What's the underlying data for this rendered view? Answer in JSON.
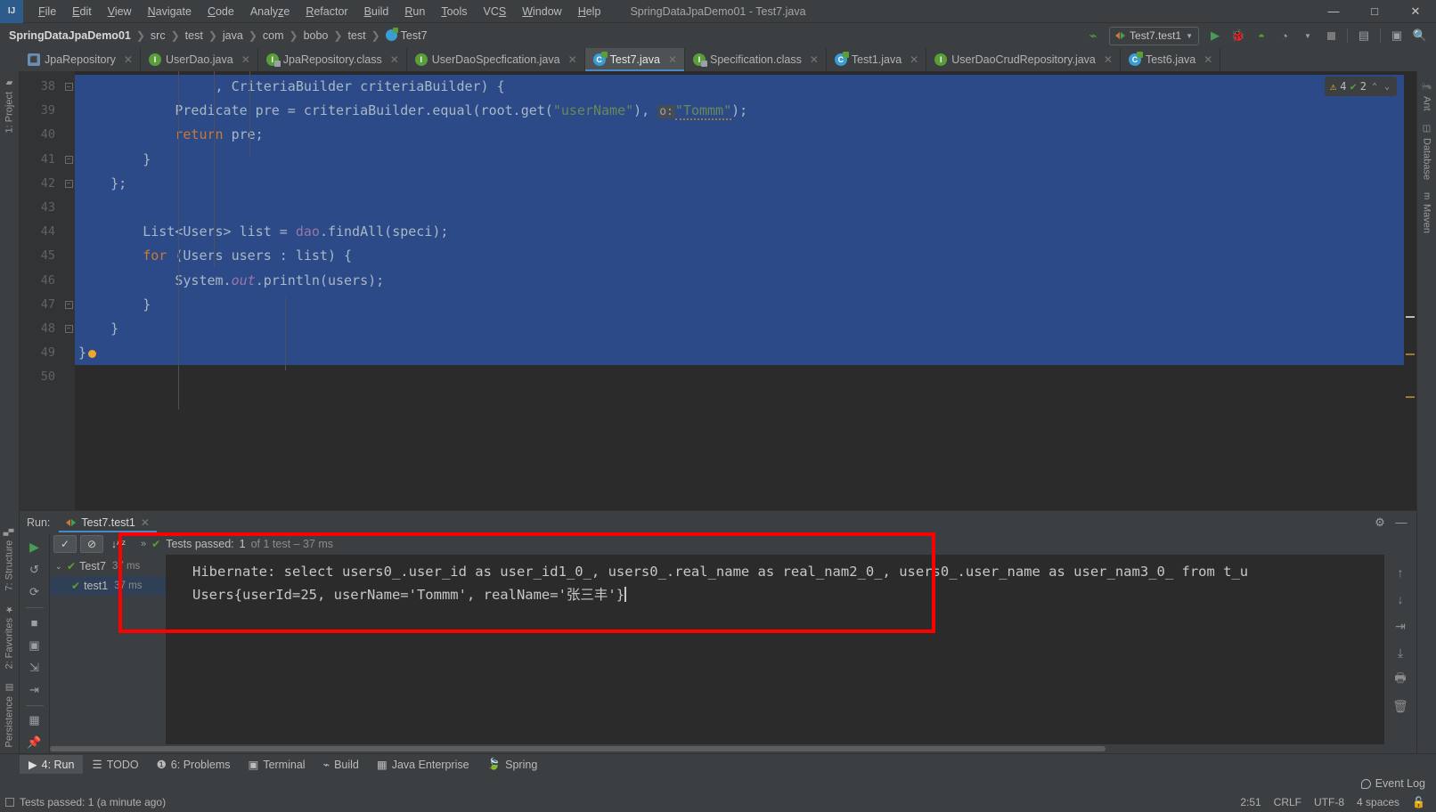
{
  "window": {
    "title": "SpringDataJpaDemo01 - Test7.java",
    "logo": "IJ",
    "minimize": "—",
    "maximize": "□",
    "close": "✕"
  },
  "menu": [
    {
      "label": "File"
    },
    {
      "label": "Edit"
    },
    {
      "label": "View"
    },
    {
      "label": "Navigate"
    },
    {
      "label": "Code"
    },
    {
      "label": "Analyze"
    },
    {
      "label": "Refactor"
    },
    {
      "label": "Build"
    },
    {
      "label": "Run"
    },
    {
      "label": "Tools"
    },
    {
      "label": "VCS"
    },
    {
      "label": "Window"
    },
    {
      "label": "Help"
    }
  ],
  "breadcrumbs": [
    {
      "label": "SpringDataJpaDemo01"
    },
    {
      "label": "src"
    },
    {
      "label": "test"
    },
    {
      "label": "java"
    },
    {
      "label": "com"
    },
    {
      "label": "bobo"
    },
    {
      "label": "test"
    },
    {
      "label": "Test7"
    }
  ],
  "toolbar": {
    "run_config": "Test7.test1",
    "build_title": "build-hammer-icon",
    "run_title": "Run",
    "debug_title": "Debug",
    "coverage_title": "Run with Coverage",
    "profile_title": "Profiler",
    "stop_title": "Stop",
    "updates_title": "Update Project",
    "search_title": "Search Everywhere"
  },
  "editor_tabs": [
    {
      "label": "JpaRepository",
      "icon": "repository-icon",
      "active": false
    },
    {
      "label": "UserDao.java",
      "icon": "interface-icon",
      "active": false
    },
    {
      "label": "JpaRepository.class",
      "icon": "class-file-icon",
      "active": false
    },
    {
      "label": "UserDaoSpecfication.java",
      "icon": "interface-icon",
      "active": false
    },
    {
      "label": "Test7.java",
      "icon": "test-class-icon",
      "active": true
    },
    {
      "label": "Specification.class",
      "icon": "class-file-icon",
      "active": false
    },
    {
      "label": "Test1.java",
      "icon": "test-class-icon",
      "active": false
    },
    {
      "label": "UserDaoCrudRepository.java",
      "icon": "interface-icon",
      "active": false
    },
    {
      "label": "Test6.java",
      "icon": "test-class-icon",
      "active": false
    }
  ],
  "left_rail": [
    {
      "label": "1: Project",
      "icon": "folder-icon"
    },
    {
      "label": "7: Structure",
      "icon": "structure-icon"
    },
    {
      "label": "2: Favorites",
      "icon": "star-icon"
    },
    {
      "label": "Persistence",
      "icon": "persistence-icon"
    }
  ],
  "right_rail": [
    {
      "label": "Ant",
      "icon": "ant-icon"
    },
    {
      "label": "Database",
      "icon": "database-icon"
    },
    {
      "label": "Maven",
      "icon": "maven-icon"
    }
  ],
  "editor": {
    "first_line": 38,
    "lines": [
      {
        "num": 38,
        "selected": true,
        "fold": "minus",
        "tokens": [
          {
            "t": "            , CriteriaBuilder criteriaBuilder) {",
            "c": "n"
          }
        ]
      },
      {
        "num": 39,
        "selected": true,
        "fold": "",
        "tokens": []
      },
      {
        "num": 40,
        "selected": true,
        "fold": "",
        "tokens": []
      },
      {
        "num": 41,
        "selected": true,
        "fold": "minus",
        "tokens": []
      },
      {
        "num": 42,
        "selected": true,
        "fold": "minus",
        "tokens": []
      },
      {
        "num": 43,
        "selected": true,
        "fold": "",
        "tokens": []
      },
      {
        "num": 44,
        "selected": true,
        "fold": "",
        "tokens": []
      },
      {
        "num": 45,
        "selected": true,
        "fold": "",
        "tokens": []
      },
      {
        "num": 46,
        "selected": true,
        "fold": "",
        "tokens": []
      },
      {
        "num": 47,
        "selected": true,
        "fold": "minus",
        "tokens": []
      },
      {
        "num": 48,
        "selected": true,
        "fold": "minus",
        "tokens": []
      },
      {
        "num": 49,
        "selected": true,
        "fold": "",
        "tokens": []
      },
      {
        "num": 50,
        "selected": false,
        "fold": "",
        "tokens": []
      }
    ],
    "code_text": {
      "l38_comma": ",",
      "l38_rest": " CriteriaBuilder criteriaBuilder) {",
      "l39_a": "Predicate pre = criteriaBuilder.equal(root.get(",
      "l39_str1": "\"userName\"",
      "l39_b": "), ",
      "l39_hint": "o:",
      "l39_str2": "\"Tommm\"",
      "l39_c": ");",
      "l40_kw": "return",
      "l40_rest": " pre;",
      "l41": "}",
      "l42": "};",
      "l44_a": "List<Users> list = ",
      "l44_dao": "dao",
      "l44_b": ".findAll(speci);",
      "l45_kw": "for",
      "l45_rest": " (Users users : list) {",
      "l46_a": "System.",
      "l46_out": "out",
      "l46_b": ".println(users);",
      "l47": "}",
      "l48": "}",
      "l49": "}"
    },
    "inspection": {
      "warning_count": "4",
      "ok_count": "2",
      "up": "⌃",
      "down": "⌄"
    }
  },
  "run_panel": {
    "label": "Run:",
    "tab": "Test7.test1",
    "tab_close": "✕",
    "settings_icon": "gear-icon",
    "hide_icon": "minimize-icon",
    "left_toolbar": [
      {
        "name": "rerun-icon",
        "glyph": "▶"
      },
      {
        "name": "rerun-failed-icon",
        "glyph": "↺"
      },
      {
        "name": "toggle-auto-test-icon",
        "glyph": "⟳"
      },
      {
        "name": "stop-icon",
        "glyph": "■"
      },
      {
        "name": "export-icon",
        "glyph": "▣"
      },
      {
        "name": "import-icon",
        "glyph": "⇲"
      },
      {
        "name": "open-icon",
        "glyph": "⇥"
      },
      {
        "name": "layout-icon",
        "glyph": "▦"
      },
      {
        "name": "pin-icon",
        "glyph": "📌"
      }
    ],
    "toggles": [
      {
        "name": "show-passed-toggle",
        "glyph": "✓",
        "on": true
      },
      {
        "name": "hide-ignored-toggle",
        "glyph": "⊘",
        "on": true
      },
      {
        "name": "sort-alphabetically-toggle",
        "glyph": "↓ᴬᶻ",
        "on": false
      }
    ],
    "status": {
      "expand_glyph": "»",
      "check_glyph": "✔",
      "prefix": "Tests passed:",
      "count": "1",
      "suffix": "of 1 test – 37 ms"
    },
    "tree": [
      {
        "label": "Test7",
        "time": "37 ms",
        "expanded": true,
        "selected": false,
        "level": 0
      },
      {
        "label": "test1",
        "time": "37 ms",
        "expanded": false,
        "selected": true,
        "level": 1
      }
    ],
    "console_lines": [
      "Hibernate: select users0_.user_id as user_id1_0_, users0_.real_name as real_nam2_0_, users0_.user_name as user_nam3_0_ from t_u",
      "Users{userId=25, userName='Tommm', realName='张三丰'}"
    ],
    "console_right_toolbar": [
      {
        "name": "scroll-up-icon",
        "glyph": "↑"
      },
      {
        "name": "scroll-down-icon",
        "glyph": "↓"
      },
      {
        "name": "soft-wrap-icon",
        "glyph": "⇥"
      },
      {
        "name": "scroll-to-end-icon",
        "glyph": "⤓"
      },
      {
        "name": "print-icon",
        "glyph": "🖶"
      },
      {
        "name": "clear-all-icon",
        "glyph": "🗑"
      }
    ]
  },
  "bottom_bar": [
    {
      "label": "4: Run",
      "icon": "play-icon",
      "active": true
    },
    {
      "label": "TODO",
      "icon": "todo-icon",
      "active": false
    },
    {
      "label": "6: Problems",
      "icon": "problems-icon",
      "active": false
    },
    {
      "label": "Terminal",
      "icon": "terminal-icon",
      "active": false
    },
    {
      "label": "Build",
      "icon": "hammer-icon",
      "active": false
    },
    {
      "label": "Java Enterprise",
      "icon": "java-enterprise-icon",
      "active": false
    },
    {
      "label": "Spring",
      "icon": "spring-leaf-icon",
      "active": false
    }
  ],
  "status_bar": {
    "message": "Tests passed: 1 (a minute ago)",
    "event_log": "Event Log",
    "caret_position": "2:51",
    "line_separator": "CRLF",
    "encoding": "UTF-8",
    "indent": "4 spaces",
    "lock_icon": "unlocked-icon"
  },
  "colors": {
    "chrome": "#3c3f41",
    "editor_bg": "#2b2b2b",
    "selection": "#2c4a87",
    "accent_blue": "#4a88c7",
    "green": "#5a9e3a",
    "annotation_red": "#ff0000"
  }
}
